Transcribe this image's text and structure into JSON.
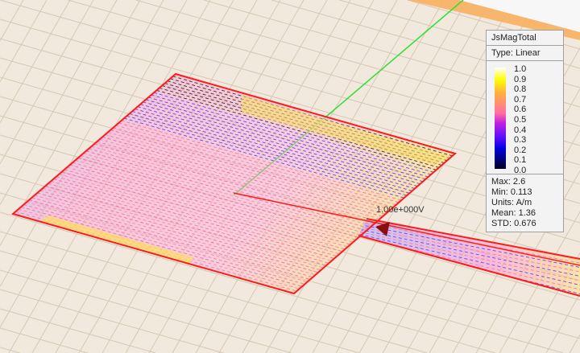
{
  "legend": {
    "title": "JsMagTotal",
    "type_label": "Type: Linear",
    "ticks": [
      "1.0",
      "0.9",
      "0.8",
      "0.7",
      "0.6",
      "0.5",
      "0.4",
      "0.3",
      "0.2",
      "0.1",
      "0.0"
    ],
    "max": "Max: 2.6",
    "min": "Min: 0.113",
    "units": "Units: A/m",
    "mean": "Mean: 1.36",
    "std": "STD: 0.676"
  },
  "port_label": "1.00e+000V",
  "colors": {
    "outline": "#ff1a1a",
    "axis": "#33dd33",
    "ground": "#f1e9dd",
    "grid": "#d6c8b4",
    "strip": "#f8b060",
    "port": "#8b0f0f"
  }
}
